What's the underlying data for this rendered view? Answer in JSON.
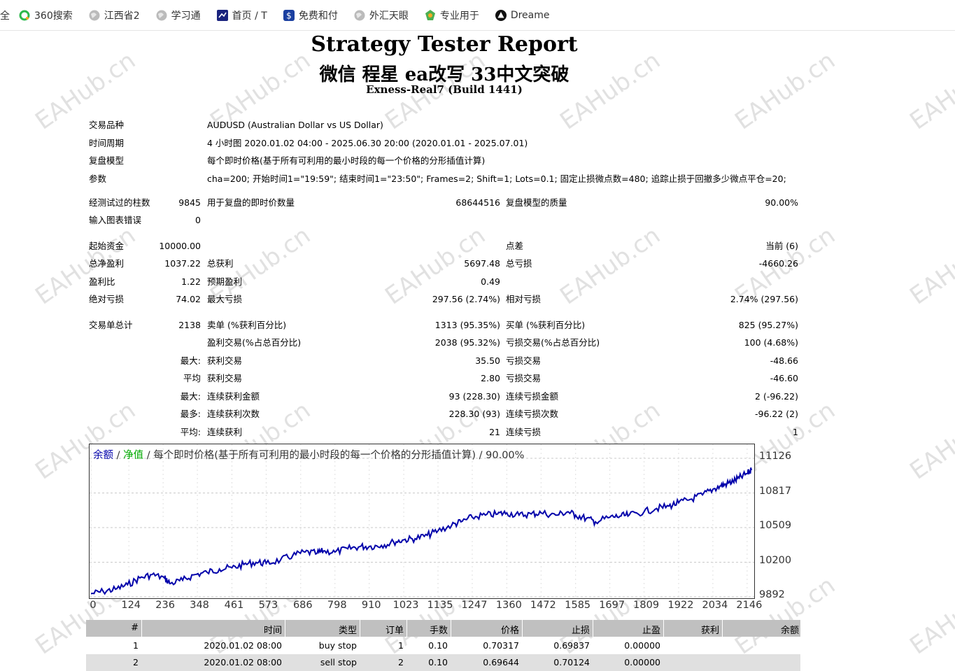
{
  "bookmarks": [
    {
      "label": "全",
      "icon": "none"
    },
    {
      "label": "360搜索",
      "icon": "search-360-icon"
    },
    {
      "label": "江西省2",
      "icon": "globe-icon"
    },
    {
      "label": "学习通",
      "icon": "globe-icon"
    },
    {
      "label": "首页 / T",
      "icon": "app-icon"
    },
    {
      "label": "免费和付",
      "icon": "dollar-icon"
    },
    {
      "label": "外汇天眼",
      "icon": "globe-icon"
    },
    {
      "label": "专业用于",
      "icon": "maps-icon"
    },
    {
      "label": "Dreame",
      "icon": "triangle-icon"
    }
  ],
  "report": {
    "title": "Strategy Tester Report",
    "subtitle": "微信 程星 ea改写 33中文突破",
    "build": "Exness-Real7 (Build 1441)"
  },
  "settings": [
    {
      "label": "交易品种",
      "value": "AUDUSD (Australian Dollar vs US Dollar)"
    },
    {
      "label": "时间周期",
      "value": "4 小时图 2020.01.02 04:00 - 2025.06.30 20:00 (2020.01.01 - 2025.07.01)"
    },
    {
      "label": "复盘模型",
      "value": "每个即时价格(基于所有可利用的最小时段的每一个价格的分形插值计算)"
    },
    {
      "label": "参数",
      "value": "cha=200; 开始时间1=\"19:59\"; 结束时间1=\"23:50\"; Frames=2; Shift=1; Lots=0.1; 固定止损微点数=480; 追踪止损于回撤多少微点平仓=20;"
    }
  ],
  "bars": {
    "bars_label": "经测试过的柱数",
    "bars_value": "9845",
    "ticks_label": "用于复盘的即时价数量",
    "ticks_value": "68644516",
    "quality_label": "复盘模型的质量",
    "quality_value": "90.00%",
    "errors_label": "输入图表错误",
    "errors_value": "0"
  },
  "money": {
    "deposit_label": "起始资金",
    "deposit_value": "10000.00",
    "spread_label": "点差",
    "spread_value": "当前 (6)",
    "net_label": "总净盈利",
    "net_value": "1037.22",
    "gross_profit_label": "总获利",
    "gross_profit_value": "5697.48",
    "gross_loss_label": "总亏损",
    "gross_loss_value": "-4660.26",
    "pf_label": "盈利比",
    "pf_value": "1.22",
    "exp_label": "预期盈利",
    "exp_value": "0.49",
    "abs_dd_label": "绝对亏损",
    "abs_dd_value": "74.02",
    "max_dd_label": "最大亏损",
    "max_dd_value": "297.56 (2.74%)",
    "rel_dd_label": "相对亏损",
    "rel_dd_value": "2.74% (297.56)"
  },
  "trades": {
    "total_label": "交易单总计",
    "total_value": "2138",
    "short_label": "卖单 (%获利百分比)",
    "short_value": "1313 (95.35%)",
    "long_label": "买单 (%获利百分比)",
    "long_value": "825 (95.27%)",
    "win_label": "盈利交易(%占总百分比)",
    "win_value": "2038 (95.32%)",
    "loss_label": "亏损交易(%占总百分比)",
    "loss_value": "100 (4.68%)",
    "rows": [
      {
        "prefix": "最大:",
        "a_label": "获利交易",
        "a_value": "35.50",
        "b_label": "亏损交易",
        "b_value": "-48.66"
      },
      {
        "prefix": "平均",
        "a_label": "获利交易",
        "a_value": "2.80",
        "b_label": "亏损交易",
        "b_value": "-46.60"
      },
      {
        "prefix": "最大:",
        "a_label": "连续获利金额",
        "a_value": "93 (228.30)",
        "b_label": "连续亏损金额",
        "b_value": "2 (-96.22)"
      },
      {
        "prefix": "最多:",
        "a_label": "连续获利次数",
        "a_value": "228.30 (93)",
        "b_label": "连续亏损次数",
        "b_value": "-96.22 (2)"
      },
      {
        "prefix": "平均:",
        "a_label": "连续获利",
        "a_value": "21",
        "b_label": "连续亏损",
        "b_value": "1"
      }
    ]
  },
  "chart_legend": {
    "balance": "余额",
    "sep1": " / ",
    "equity": "净值",
    "sep2": " / ",
    "rest": "每个即时价格(基于所有可利用的最小时段的每一个价格的分形插值计算) / 90.00%"
  },
  "chart_data": {
    "type": "line",
    "yticks": [
      "11126",
      "10817",
      "10509",
      "10200",
      "9892"
    ],
    "xticks": [
      "0",
      "124",
      "236",
      "348",
      "461",
      "573",
      "686",
      "798",
      "910",
      "1023",
      "1135",
      "1247",
      "1360",
      "1472",
      "1585",
      "1697",
      "1809",
      "1922",
      "2034",
      "2146"
    ],
    "ylim": [
      9892,
      11126
    ],
    "xlim": [
      0,
      2160
    ],
    "series": [
      {
        "name": "余额",
        "color": "#0000aa",
        "x": [
          0,
          40,
          80,
          120,
          160,
          200,
          240,
          260,
          300,
          340,
          380,
          420,
          461,
          500,
          540,
          573,
          620,
          660,
          700,
          740,
          760,
          798,
          840,
          880,
          910,
          950,
          990,
          1023,
          1060,
          1100,
          1135,
          1180,
          1210,
          1247,
          1290,
          1330,
          1360,
          1400,
          1440,
          1472,
          1520,
          1560,
          1585,
          1620,
          1650,
          1697,
          1730,
          1760,
          1809,
          1850,
          1890,
          1922,
          1960,
          2000,
          2034,
          2060,
          2080,
          2100,
          2120,
          2146,
          2160
        ],
        "y": [
          9920,
          9940,
          9960,
          10000,
          10060,
          10090,
          10060,
          10010,
          10040,
          10090,
          10110,
          10140,
          10150,
          10180,
          10200,
          10190,
          10220,
          10260,
          10290,
          10280,
          10300,
          10290,
          10320,
          10340,
          10340,
          10350,
          10380,
          10400,
          10410,
          10440,
          10480,
          10530,
          10560,
          10600,
          10620,
          10630,
          10640,
          10620,
          10630,
          10640,
          10620,
          10650,
          10620,
          10590,
          10560,
          10600,
          10610,
          10620,
          10650,
          10680,
          10700,
          10730,
          10760,
          10800,
          10850,
          10880,
          10900,
          10920,
          10950,
          10990,
          11020
        ]
      }
    ]
  },
  "orders": {
    "headers": [
      "#",
      "时间",
      "类型",
      "订单",
      "手数",
      "价格",
      "止损",
      "止盈",
      "获利",
      "余额"
    ],
    "rows": [
      [
        "1",
        "2020.01.02 08:00",
        "buy stop",
        "1",
        "0.10",
        "0.70317",
        "0.69837",
        "0.00000",
        "",
        ""
      ],
      [
        "2",
        "2020.01.02 08:00",
        "sell stop",
        "2",
        "0.10",
        "0.69644",
        "0.70124",
        "0.00000",
        "",
        ""
      ]
    ]
  },
  "watermark": "EAHub.cn"
}
